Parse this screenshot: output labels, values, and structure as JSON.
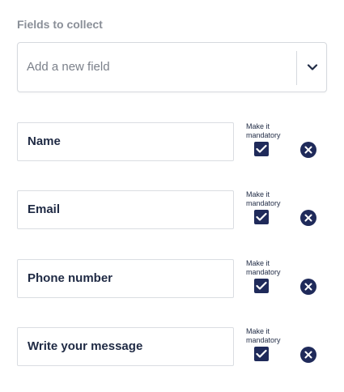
{
  "section": {
    "label": "Fields to collect"
  },
  "add_field": {
    "placeholder": "Add a new field"
  },
  "mandatory_label": "Make it mandatory",
  "fields": [
    {
      "name": "Name",
      "mandatory": true
    },
    {
      "name": "Email",
      "mandatory": true
    },
    {
      "name": "Phone number",
      "mandatory": true
    },
    {
      "name": "Write your message",
      "mandatory": true
    }
  ],
  "icons": {
    "dropdown": "chevron-down-icon",
    "check": "check-icon",
    "remove": "close-circle-icon"
  },
  "colors": {
    "accent": "#1f2a5a",
    "text": "#1f2a44",
    "muted": "#8a8f98",
    "border": "#d6d9de"
  }
}
